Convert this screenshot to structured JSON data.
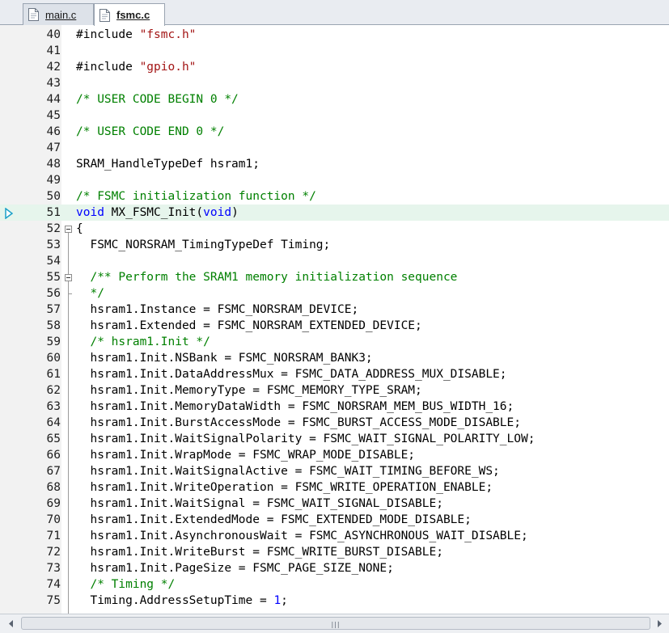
{
  "tabs": [
    {
      "label": "main.c",
      "active": false,
      "icon": "file-icon"
    },
    {
      "label": "fsmc.c",
      "active": true,
      "icon": "file-icon"
    }
  ],
  "editor": {
    "current_line": "51",
    "lines": [
      {
        "num": "40",
        "text": "#include \"fsmc.h\""
      },
      {
        "num": "41",
        "text": ""
      },
      {
        "num": "42",
        "text": "#include \"gpio.h\""
      },
      {
        "num": "43",
        "text": ""
      },
      {
        "num": "44",
        "text": "/* USER CODE BEGIN 0 */"
      },
      {
        "num": "45",
        "text": ""
      },
      {
        "num": "46",
        "text": "/* USER CODE END 0 */"
      },
      {
        "num": "47",
        "text": ""
      },
      {
        "num": "48",
        "text": "SRAM_HandleTypeDef hsram1;"
      },
      {
        "num": "49",
        "text": ""
      },
      {
        "num": "50",
        "text": "/* FSMC initialization function */"
      },
      {
        "num": "51",
        "text": "void MX_FSMC_Init(void)"
      },
      {
        "num": "52",
        "text": "{"
      },
      {
        "num": "53",
        "text": "  FSMC_NORSRAM_TimingTypeDef Timing;"
      },
      {
        "num": "54",
        "text": ""
      },
      {
        "num": "55",
        "text": "  /** Perform the SRAM1 memory initialization sequence"
      },
      {
        "num": "56",
        "text": "  */"
      },
      {
        "num": "57",
        "text": "  hsram1.Instance = FSMC_NORSRAM_DEVICE;"
      },
      {
        "num": "58",
        "text": "  hsram1.Extended = FSMC_NORSRAM_EXTENDED_DEVICE;"
      },
      {
        "num": "59",
        "text": "  /* hsram1.Init */"
      },
      {
        "num": "60",
        "text": "  hsram1.Init.NSBank = FSMC_NORSRAM_BANK3;"
      },
      {
        "num": "61",
        "text": "  hsram1.Init.DataAddressMux = FSMC_DATA_ADDRESS_MUX_DISABLE;"
      },
      {
        "num": "62",
        "text": "  hsram1.Init.MemoryType = FSMC_MEMORY_TYPE_SRAM;"
      },
      {
        "num": "63",
        "text": "  hsram1.Init.MemoryDataWidth = FSMC_NORSRAM_MEM_BUS_WIDTH_16;"
      },
      {
        "num": "64",
        "text": "  hsram1.Init.BurstAccessMode = FSMC_BURST_ACCESS_MODE_DISABLE;"
      },
      {
        "num": "65",
        "text": "  hsram1.Init.WaitSignalPolarity = FSMC_WAIT_SIGNAL_POLARITY_LOW;"
      },
      {
        "num": "66",
        "text": "  hsram1.Init.WrapMode = FSMC_WRAP_MODE_DISABLE;"
      },
      {
        "num": "67",
        "text": "  hsram1.Init.WaitSignalActive = FSMC_WAIT_TIMING_BEFORE_WS;"
      },
      {
        "num": "68",
        "text": "  hsram1.Init.WriteOperation = FSMC_WRITE_OPERATION_ENABLE;"
      },
      {
        "num": "69",
        "text": "  hsram1.Init.WaitSignal = FSMC_WAIT_SIGNAL_DISABLE;"
      },
      {
        "num": "70",
        "text": "  hsram1.Init.ExtendedMode = FSMC_EXTENDED_MODE_DISABLE;"
      },
      {
        "num": "71",
        "text": "  hsram1.Init.AsynchronousWait = FSMC_ASYNCHRONOUS_WAIT_DISABLE;"
      },
      {
        "num": "72",
        "text": "  hsram1.Init.WriteBurst = FSMC_WRITE_BURST_DISABLE;"
      },
      {
        "num": "73",
        "text": "  hsram1.Init.PageSize = FSMC_PAGE_SIZE_NONE;"
      },
      {
        "num": "74",
        "text": "  /* Timing */"
      },
      {
        "num": "75",
        "text": "  Timing.AddressSetupTime = 1;"
      }
    ]
  },
  "colors": {
    "keyword": "#0000ff",
    "string": "#a31515",
    "comment": "#008000",
    "current_line_bg": "#e6f5ec",
    "gutter_bg": "#f2f2f2",
    "execution_arrow": "#1aa0c8"
  },
  "scrollbar": {
    "grip_icon": "grip-icon",
    "left": "arrow-left-icon",
    "right": "arrow-right-icon"
  }
}
